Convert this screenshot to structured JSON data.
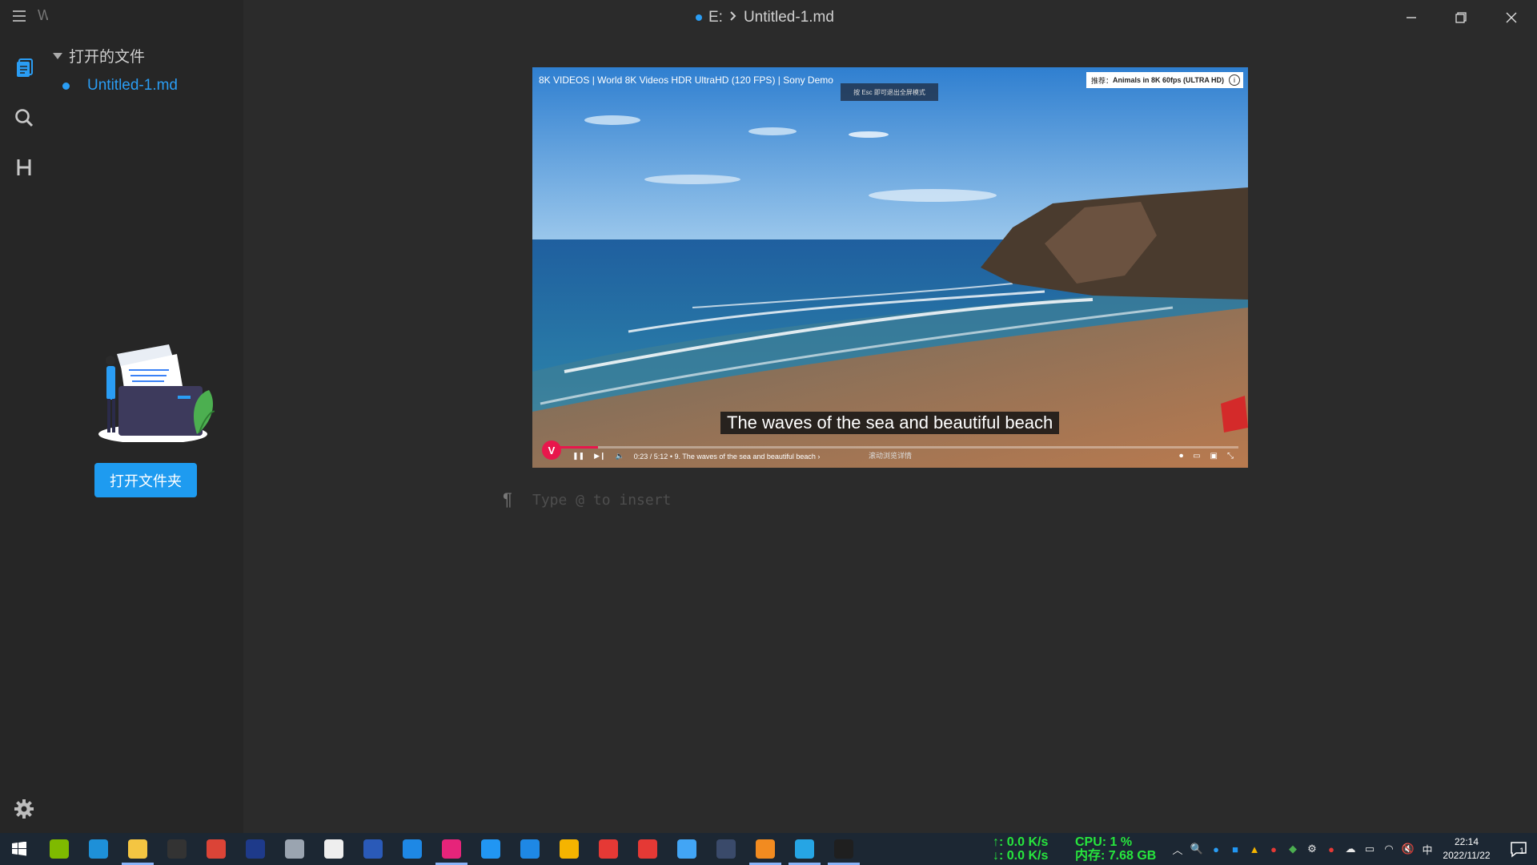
{
  "window": {
    "workspace_name": "W 2",
    "breadcrumb_drive": "E:",
    "breadcrumb_file": "Untitled-1.md"
  },
  "sidebar": {
    "open_files_header": "打开的文件",
    "file_item": "Untitled-1.md",
    "open_folder_button": "打开文件夹",
    "activity_icons": [
      "files-icon",
      "search-icon",
      "heading-icon"
    ]
  },
  "video": {
    "title": "8K VIDEOS | World 8K Videos HDR UltraHD (120 FPS) | Sony Demo",
    "esc_hint": "按 Esc 即可退出全屏模式",
    "recommend_label": "推荐：",
    "recommend_title": "Animals in 8K 60fps (ULTRA HD)",
    "subtitle": "The waves of the sea and beautiful beach",
    "time_display": "0:23 / 5:12 • 9. The waves of the sea and beautiful beach ›",
    "scroll_hint": "滚动浏览详情",
    "progress": 0.074
  },
  "editor": {
    "placeholder": "Type @ to insert"
  },
  "taskbar": {
    "apps": [
      {
        "name": "taskbar-app-1",
        "color": "#7fba00"
      },
      {
        "name": "taskbar-app-edge",
        "color": "#1e90d8"
      },
      {
        "name": "taskbar-app-explorer",
        "color": "#f4c542"
      },
      {
        "name": "taskbar-app-terminal",
        "color": "#333333"
      },
      {
        "name": "taskbar-app-chrome",
        "color": "#db4437"
      },
      {
        "name": "taskbar-app-6",
        "color": "#1e3a8a"
      },
      {
        "name": "taskbar-app-7",
        "color": "#9aa4b0"
      },
      {
        "name": "taskbar-app-qq",
        "color": "#eeeeee"
      },
      {
        "name": "taskbar-app-powershell",
        "color": "#2a5ab8"
      },
      {
        "name": "taskbar-app-10",
        "color": "#1e88e5"
      },
      {
        "name": "taskbar-app-jetbrains",
        "color": "#e6247a"
      },
      {
        "name": "taskbar-app-12",
        "color": "#2196f3"
      },
      {
        "name": "taskbar-app-13",
        "color": "#1e88e5"
      },
      {
        "name": "taskbar-app-14",
        "color": "#f5b400"
      },
      {
        "name": "taskbar-app-15",
        "color": "#e53935"
      },
      {
        "name": "taskbar-app-16",
        "color": "#e53935"
      },
      {
        "name": "taskbar-app-17",
        "color": "#42a5f5"
      },
      {
        "name": "taskbar-app-18",
        "color": "#3a4a6a"
      },
      {
        "name": "taskbar-app-sublime",
        "color": "#f28b20"
      },
      {
        "name": "taskbar-app-20",
        "color": "#26a5e4"
      },
      {
        "name": "taskbar-app-typora",
        "color": "#1f1f1f"
      }
    ],
    "net_up": "↑: 0.0 K/s",
    "net_down": "↓: 0.0 K/s",
    "cpu": "CPU: 1 %",
    "memory": "内存: 7.68 GB",
    "ime": "中",
    "time": "22:14",
    "date": "2022/11/22",
    "notification_count": "1",
    "accent": "#2a9df4",
    "stats_color": "#27e63d"
  }
}
